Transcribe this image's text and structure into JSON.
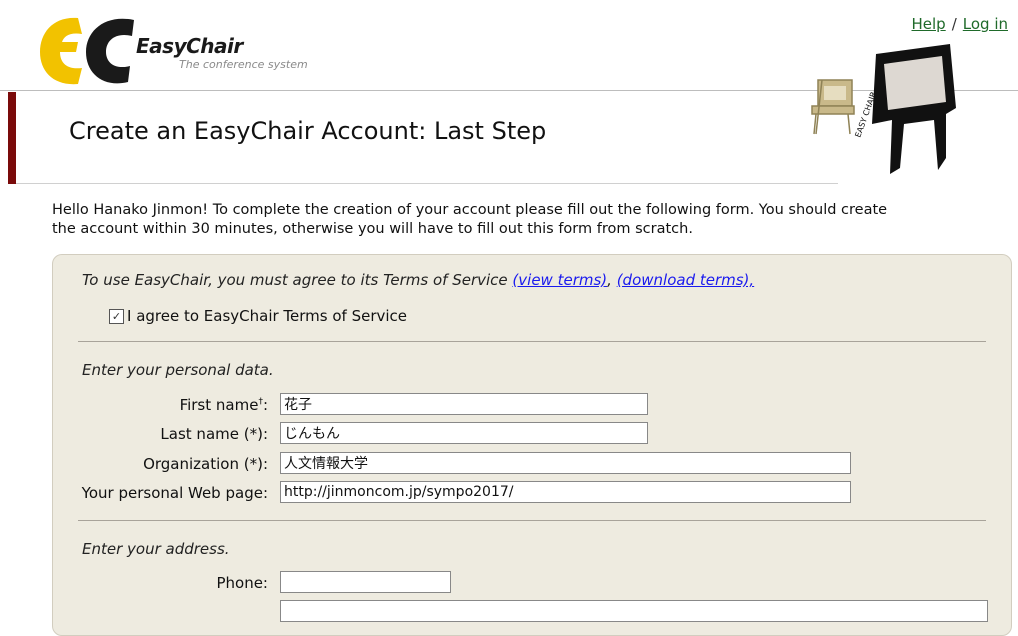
{
  "header": {
    "logo_text": "EasyChair",
    "logo_tagline": "The conference system",
    "help_link": "Help",
    "separator": "/",
    "login_link": "Log in"
  },
  "page_title": "Create an EasyChair Account: Last Step",
  "intro": "Hello Hanako Jinmon! To complete the creation of your account please fill out the following form. You should create the account within 30 minutes, otherwise you will have to fill out this form from scratch.",
  "terms": {
    "text": "To use EasyChair, you must agree to its Terms of Service",
    "view_link": "(view terms)",
    "download_link": "(download terms),",
    "agree_label": "I agree to EasyChair Terms of Service",
    "agree_checked": true
  },
  "personal": {
    "heading": "Enter your personal data.",
    "first_name_label": "First name",
    "first_name_mark": "†",
    "first_name_value": "花子",
    "last_name_label": "Last name (*):",
    "last_name_value": "じんもん",
    "org_label": "Organization (*):",
    "org_value": "人文情報大学",
    "web_label": "Your personal Web page:",
    "web_value": "http://jinmoncom.jp/sympo2017/"
  },
  "address": {
    "heading": "Enter your address.",
    "phone_label": "Phone:",
    "phone_value": ""
  },
  "colors": {
    "title_bar": "#7a0a0a",
    "form_bg": "#eeebe0",
    "logo_yellow": "#f2c200",
    "link_green": "#1f6a2a"
  }
}
